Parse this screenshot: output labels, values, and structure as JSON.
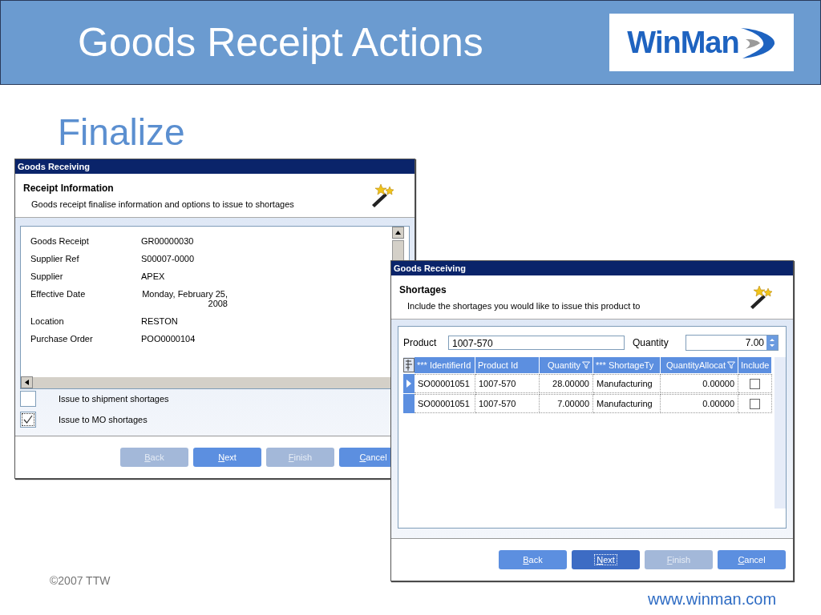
{
  "header": {
    "title": "Goods Receipt Actions",
    "logo": "WinMan"
  },
  "heading": "Finalize",
  "receipt_window": {
    "title": "Goods Receiving",
    "section": "Receipt Information",
    "description": "Goods receipt finalise information and options to issue to shortages",
    "fields": [
      {
        "label": "Goods Receipt",
        "value": "GR00000030"
      },
      {
        "label": "Supplier Ref",
        "value": "S00007-0000"
      },
      {
        "label": "Supplier",
        "value": "APEX"
      },
      {
        "label": "Effective Date",
        "value": "Monday, February 25, 2008"
      },
      {
        "label": "Location",
        "value": "RESTON"
      },
      {
        "label": "Purchase Order",
        "value": "POO0000104"
      }
    ],
    "options": [
      {
        "label": "Issue to shipment shortages",
        "checked": false
      },
      {
        "label": "Issue to MO shortages",
        "checked": true
      }
    ],
    "buttons": [
      {
        "label": "Back",
        "disabled": true,
        "focused": false
      },
      {
        "label": "Next",
        "disabled": false,
        "focused": false
      },
      {
        "label": "Finish",
        "disabled": true,
        "focused": false
      },
      {
        "label": "Cancel",
        "disabled": false,
        "focused": false
      }
    ]
  },
  "shortages_window": {
    "title": "Goods Receiving",
    "section": "Shortages",
    "description": "Include the shortages you would like to issue this product to",
    "product": {
      "label": "Product",
      "value": "1007-570"
    },
    "quantity": {
      "label": "Quantity",
      "value": "7.00"
    },
    "table": {
      "columns": [
        {
          "label": "*** IdentifierId",
          "kind": "text",
          "filter": false
        },
        {
          "label": "Product Id",
          "kind": "text",
          "filter": false
        },
        {
          "label": "Quantity",
          "kind": "number",
          "filter": true
        },
        {
          "label": "*** ShortageTy",
          "kind": "text",
          "filter": false
        },
        {
          "label": "QuantityAllocat",
          "kind": "number",
          "filter": true
        },
        {
          "label": "Include",
          "kind": "check",
          "filter": false
        }
      ],
      "rows": [
        {
          "current": true,
          "cells": [
            "SO00001051",
            "1007-570",
            "28.00000",
            "Manufacturing",
            "0.00000"
          ],
          "include": false
        },
        {
          "current": false,
          "cells": [
            "SO00001051",
            "1007-570",
            "7.00000",
            "Manufacturing",
            "0.00000"
          ],
          "include": false
        }
      ]
    },
    "buttons": [
      {
        "label": "Back",
        "disabled": false,
        "focused": false
      },
      {
        "label": "Next",
        "disabled": false,
        "focused": true
      },
      {
        "label": "Finish",
        "disabled": true,
        "focused": false
      },
      {
        "label": "Cancel",
        "disabled": false,
        "focused": false
      }
    ]
  },
  "footer": {
    "copyright": "©2007 TTW",
    "website": "www.winman.com"
  }
}
